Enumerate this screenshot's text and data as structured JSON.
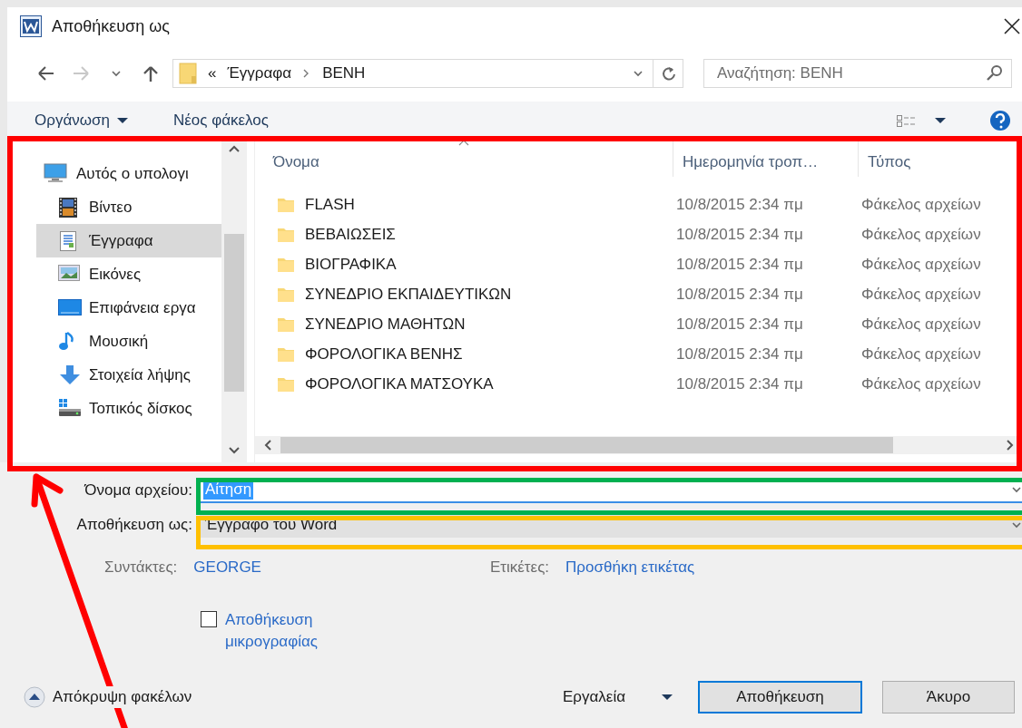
{
  "window": {
    "title": "Αποθήκευση ως"
  },
  "address": {
    "overflow": "«",
    "breadcrumbs": [
      "Έγγραφα",
      "ΒΕΝΗ"
    ]
  },
  "search": {
    "placeholder": "Αναζήτηση: ΒΕΝΗ"
  },
  "toolbar": {
    "organize": "Οργάνωση",
    "new_folder": "Νέος φάκελος"
  },
  "sidebar": {
    "items": [
      {
        "label": "Αυτός ο υπολογι",
        "kind": "computer",
        "selected": false,
        "children": [
          {
            "label": "Βίντεο",
            "kind": "video",
            "selected": false
          },
          {
            "label": "Έγγραφα",
            "kind": "documents",
            "selected": true
          },
          {
            "label": "Εικόνες",
            "kind": "pictures",
            "selected": false
          },
          {
            "label": "Επιφάνεια εργα",
            "kind": "desktop",
            "selected": false
          },
          {
            "label": "Μουσική",
            "kind": "music",
            "selected": false
          },
          {
            "label": "Στοιχεία λήψης",
            "kind": "downloads",
            "selected": false
          },
          {
            "label": "Τοπικός δίσκος",
            "kind": "drive",
            "selected": false
          }
        ]
      }
    ]
  },
  "table": {
    "columns": [
      {
        "label": "Όνομα",
        "sorted": true
      },
      {
        "label": "Ημερομηνία τροπ…",
        "sorted": false
      },
      {
        "label": "Τύπος",
        "sorted": false
      }
    ],
    "rows": [
      {
        "name": "FLASH",
        "date": "10/8/2015 2:34 πμ",
        "type": "Φάκελος αρχείων",
        "selected": false
      },
      {
        "name": "ΒΕΒΑΙΩΣΕΙΣ",
        "date": "10/8/2015 2:34 πμ",
        "type": "Φάκελος αρχείων",
        "selected": false
      },
      {
        "name": "ΒΙΟΓΡΑΦΙΚΑ",
        "date": "10/8/2015 2:34 πμ",
        "type": "Φάκελος αρχείων",
        "selected": false
      },
      {
        "name": "ΣΥΝΕΔΡΙΟ ΕΚΠΑΙΔΕΥΤΙΚΩΝ",
        "date": "10/8/2015 2:34 πμ",
        "type": "Φάκελος αρχείων",
        "selected": false
      },
      {
        "name": "ΣΥΝΕΔΡΙΟ ΜΑΘΗΤΩΝ",
        "date": "10/8/2015 2:34 πμ",
        "type": "Φάκελος αρχείων",
        "selected": false
      },
      {
        "name": "ΦΟΡΟΛΟΓΙΚΑ ΒΕΝΗΣ",
        "date": "10/8/2015 2:34 πμ",
        "type": "Φάκελος αρχείων",
        "selected": false
      },
      {
        "name": "ΦΟΡΟΛΟΓΙΚΑ ΜΑΤΣΟΥΚΑ",
        "date": "10/8/2015 2:34 πμ",
        "type": "Φάκελος αρχείων",
        "selected": false
      }
    ]
  },
  "form": {
    "filename": {
      "label": "Όνομα αρχείου:",
      "value": "Αίτηση",
      "text_selected": true
    },
    "save_type": {
      "label": "Αποθήκευση ως:",
      "value": "Έγγραφο του Word"
    },
    "authors": {
      "label": "Συντάκτες:",
      "value": "GEORGE"
    },
    "tags": {
      "label": "Ετικέτες:",
      "value": "Προσθήκη ετικέτας"
    },
    "thumbnail": {
      "label": "Αποθήκευση μικρογραφίας",
      "checked": false
    }
  },
  "footer": {
    "hide_folders": "Απόκρυψη φακέλων",
    "tools": "Εργαλεία",
    "buttons": [
      {
        "label": "Αποθήκευση",
        "default": true
      },
      {
        "label": "Άκυρο",
        "default": false
      }
    ]
  },
  "annotations": [
    {
      "kind": "browser_frame",
      "color": "#ff0000"
    },
    {
      "kind": "filename_frame",
      "color": "#00b050"
    },
    {
      "kind": "save_type_frame",
      "color": "#ffc000"
    },
    {
      "kind": "arrow",
      "color": "#ff0000"
    }
  ]
}
